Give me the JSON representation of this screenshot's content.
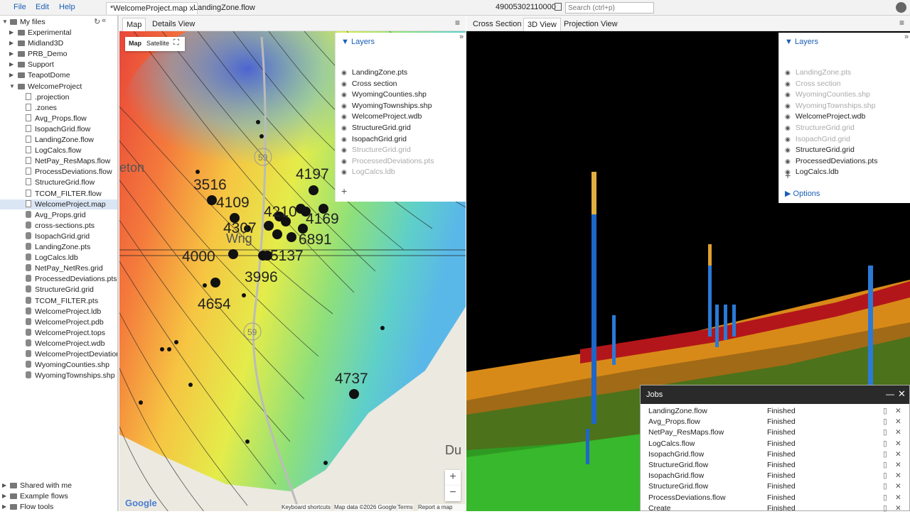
{
  "menu": {
    "file": "File",
    "edit": "Edit",
    "help": "Help"
  },
  "tabs": [
    "*WelcomeProject.map x",
    "LandingZone.flow"
  ],
  "well_id": "49005302110000",
  "search_placeholder": "Search (ctrl+p)",
  "sidebar": {
    "root": "My files",
    "folders": [
      "Experimental",
      "Midland3D",
      "PRB_Demo",
      "Support",
      "TeapotDome",
      "WelcomeProject"
    ],
    "files": [
      ".projection",
      ".zones",
      "Avg_Props.flow",
      "IsopachGrid.flow",
      "LandingZone.flow",
      "LogCalcs.flow",
      "NetPay_ResMaps.flow",
      "ProcessDeviations.flow",
      "StructureGrid.flow",
      "TCOM_FILTER.flow",
      "WelcomeProject.map",
      "Avg_Props.grid",
      "cross-sections.pts",
      "IsopachGrid.grid",
      "LandingZone.pts",
      "LogCalcs.ldb",
      "NetPay_NetRes.grid",
      "ProcessedDeviations.pts",
      "StructureGrid.grid",
      "TCOM_FILTER.pts",
      "WelcomeProject.ldb",
      "WelcomeProject.pdb",
      "WelcomeProject.tops",
      "WelcomeProject.wdb",
      "WelcomeProjectDeviations",
      "WyomingCounties.shp",
      "WyomingTownships.shp"
    ],
    "bottom": [
      "Shared with me",
      "Example flows",
      "Flow tools"
    ]
  },
  "map": {
    "tabs": [
      "Map",
      "Details View"
    ],
    "maptype": [
      "Map",
      "Satellite"
    ],
    "layers_title": "Layers",
    "layers": [
      "LandingZone.pts",
      "Cross section",
      "WyomingCounties.shp",
      "WyomingTownships.shp",
      "WelcomeProject.wdb",
      "StructureGrid.grid",
      "IsopachGrid.grid",
      "StructureGrid.grid",
      "ProcessedDeviations.pts",
      "LogCalcs.ldb"
    ],
    "add": "+",
    "labels": [
      "4197",
      "3516",
      "4109",
      "4210",
      "4169",
      "4307",
      "6891",
      "4000",
      "5137",
      "3996",
      "4654",
      "4737"
    ],
    "place": [
      "eton",
      "Wrig",
      "Du"
    ],
    "shields": [
      "59",
      "59"
    ],
    "google": "Google",
    "attrib": [
      "Keyboard shortcuts",
      "Map data ©2026 Google",
      "Terms",
      "Report a map error"
    ],
    "zoom_in": "+",
    "zoom_out": "−"
  },
  "view3d": {
    "tabs": [
      "Cross Section",
      "3D View",
      "Projection View"
    ],
    "layers_title": "Layers",
    "layers": [
      "LandingZone.pts",
      "Cross section",
      "WyomingCounties.shp",
      "WyomingTownships.shp",
      "WelcomeProject.wdb",
      "StructureGrid.grid",
      "IsopachGrid.grid",
      "StructureGrid.grid",
      "ProcessedDeviations.pts",
      "LogCalcs.ldb"
    ],
    "options": "Options",
    "add": "+"
  },
  "jobs": {
    "title": "Jobs",
    "rows": [
      [
        "LandingZone.flow",
        "Finished"
      ],
      [
        "Avg_Props.flow",
        "Finished"
      ],
      [
        "NetPay_ResMaps.flow",
        "Finished"
      ],
      [
        "LogCalcs.flow",
        "Finished"
      ],
      [
        "IsopachGrid.flow",
        "Finished"
      ],
      [
        "StructureGrid.flow",
        "Finished"
      ],
      [
        "IsopachGrid.flow",
        "Finished"
      ],
      [
        "StructureGrid.flow",
        "Finished"
      ],
      [
        "ProcessDeviations.flow",
        "Finished"
      ],
      [
        "Create",
        "Finished"
      ]
    ]
  },
  "colors": {
    "accent": "#1a5fb4",
    "selected": "#dbe6f4",
    "red_horizon": "#b01a1a",
    "orange_horizon": "#c87a10",
    "green_horizon": "#3aa82a"
  }
}
